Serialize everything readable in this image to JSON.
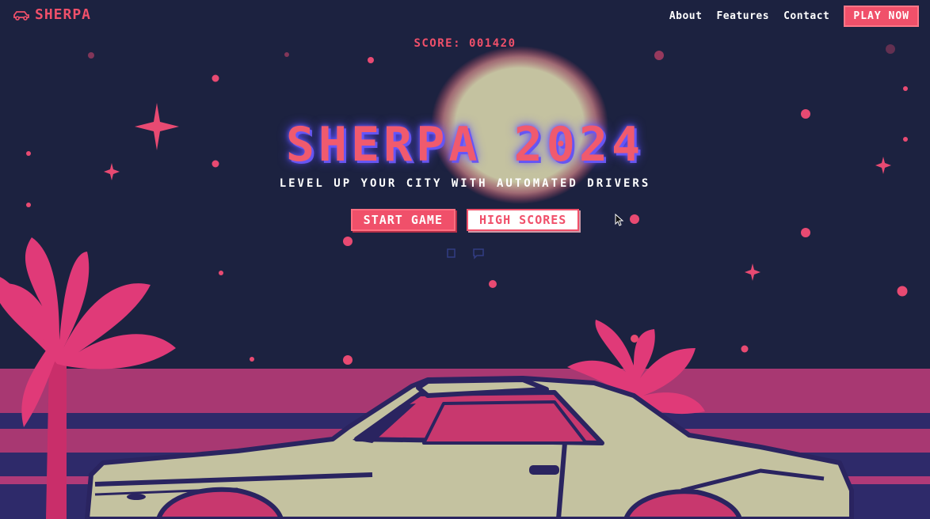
{
  "brand": {
    "name": "SHERPA",
    "icon": "car-icon",
    "color": "#f0506a"
  },
  "nav": {
    "links": [
      "About",
      "Features",
      "Contact"
    ],
    "cta": "PLAY NOW"
  },
  "score": {
    "label": "SCORE: 001420"
  },
  "hero": {
    "title": "SHERPA 2024",
    "tagline": "LEVEL UP YOUR CITY WITH AUTOMATED DRIVERS",
    "start_button": "START GAME",
    "scores_button": "HIGH SCORES"
  },
  "colors": {
    "background": "#1c2240",
    "accent": "#f0506a",
    "glow": "#6b5cff",
    "palm": "#e03a78",
    "moon": "#c4c2a0",
    "car_body": "#c4c2a0",
    "car_outline": "#2a2460",
    "stripes": [
      "#a83872",
      "#2e2a6a"
    ]
  }
}
